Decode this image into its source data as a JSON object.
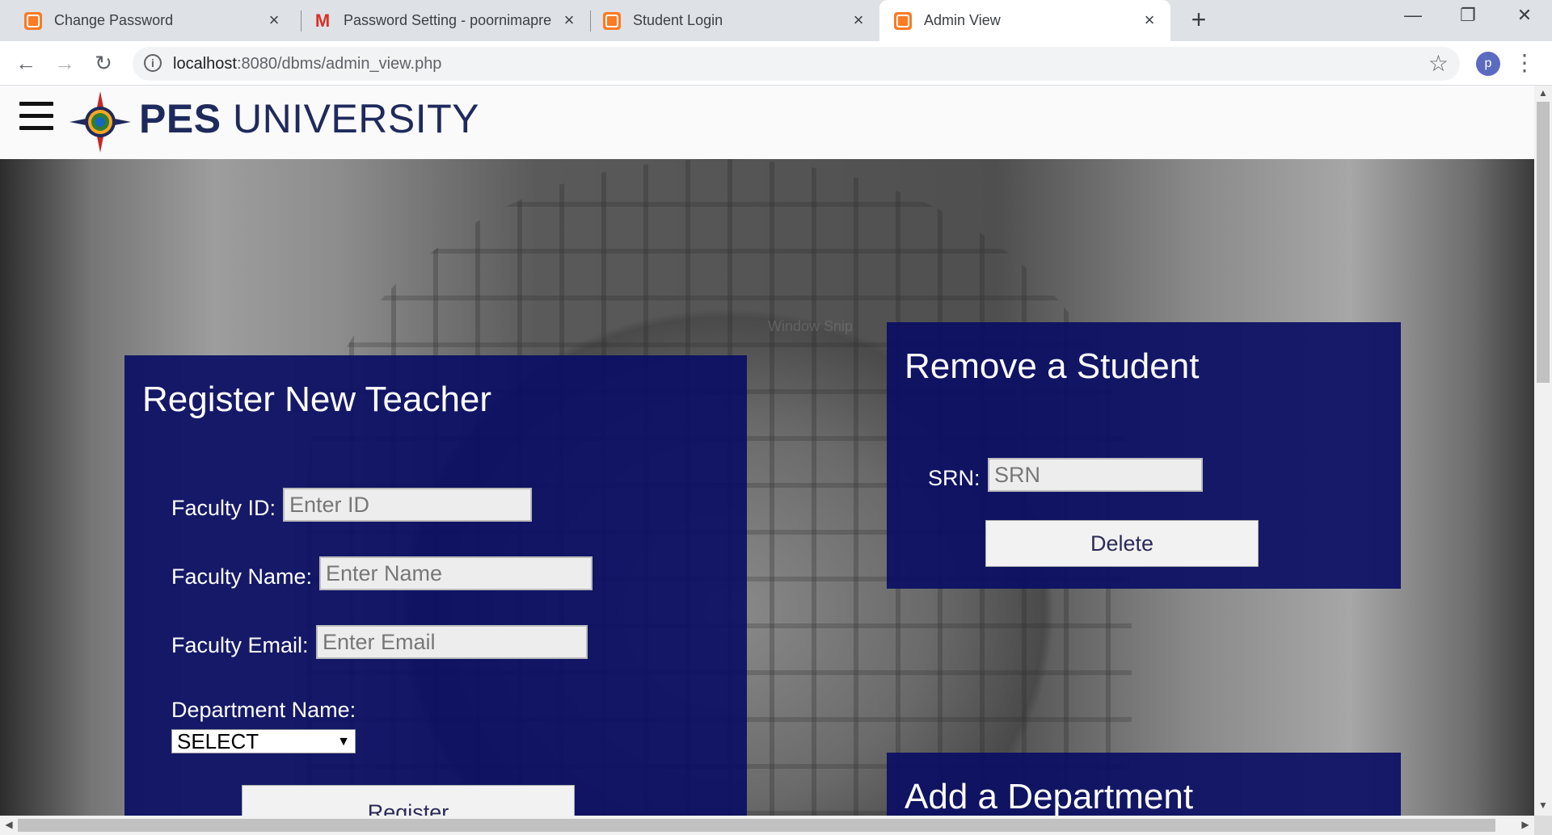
{
  "browser": {
    "tabs": [
      {
        "title": "Change Password",
        "favicon": "xampp-icon"
      },
      {
        "title": "Password Setting - poornimapre",
        "favicon": "gmail-icon"
      },
      {
        "title": "Student Login",
        "favicon": "xampp-icon"
      },
      {
        "title": "Admin View",
        "favicon": "xampp-icon",
        "active": true
      }
    ],
    "url_host": "localhost",
    "url_path": ":8080/dbms/admin_view.php",
    "profile_initial": "p"
  },
  "site": {
    "brand_bold": "PES",
    "brand_rest": "UNIVERSITY",
    "watermark": "Window Snip"
  },
  "register_teacher": {
    "heading": "Register New Teacher",
    "faculty_id_label": "Faculty ID:",
    "faculty_id_placeholder": "Enter ID",
    "faculty_name_label": "Faculty Name:",
    "faculty_name_placeholder": "Enter Name",
    "faculty_email_label": "Faculty Email:",
    "faculty_email_placeholder": "Enter Email",
    "department_label": "Department Name:",
    "department_selected": "SELECT",
    "register_button": "Register"
  },
  "remove_student": {
    "heading": "Remove a Student",
    "srn_label": "SRN:",
    "srn_placeholder": "SRN",
    "delete_button": "Delete"
  },
  "add_department": {
    "heading": "Add a Department"
  },
  "colors": {
    "panel": "#0a0e64",
    "brand": "#1f2a5c",
    "tab_strip": "#dee1e6"
  }
}
